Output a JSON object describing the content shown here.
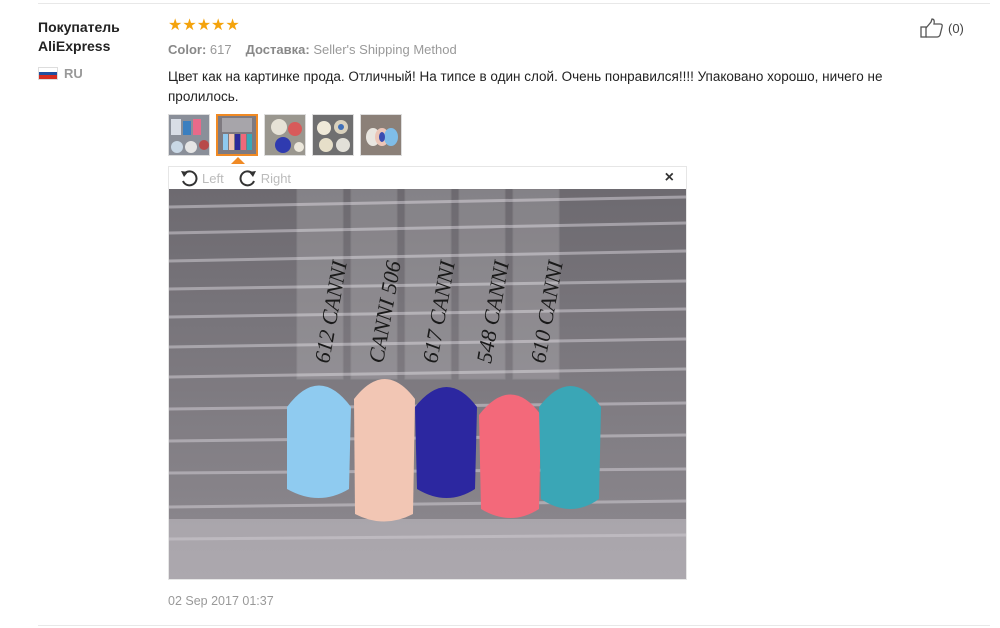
{
  "buyer": {
    "name_line1": "Покупатель",
    "name_line2": "AliExpress",
    "country": "RU",
    "flag_colors": [
      "#ffffff",
      "#1f4fa0",
      "#d52b1e"
    ]
  },
  "review": {
    "stars": "★★★★★",
    "rating": 5,
    "color_label": "Color:",
    "color_value": "617",
    "shipping_label": "Доставка:",
    "shipping_value": "Seller's Shipping Method",
    "text": "Цвет как на картинке прода. Отличный! На типсе в один слой. Очень понравился!!!! Упаковано хорошо, ничего не пролилось.",
    "date": "02 Sep 2017 01:37"
  },
  "thumbnails": {
    "count": 5,
    "active_index": 1
  },
  "viewer": {
    "rotate_left": "Left",
    "rotate_right": "Right",
    "close": "×"
  },
  "helpful": {
    "count": "(0)",
    "icon": "thumbs-up-icon"
  },
  "colors": {
    "star": "#f4a30c",
    "accent": "#f08a24"
  }
}
